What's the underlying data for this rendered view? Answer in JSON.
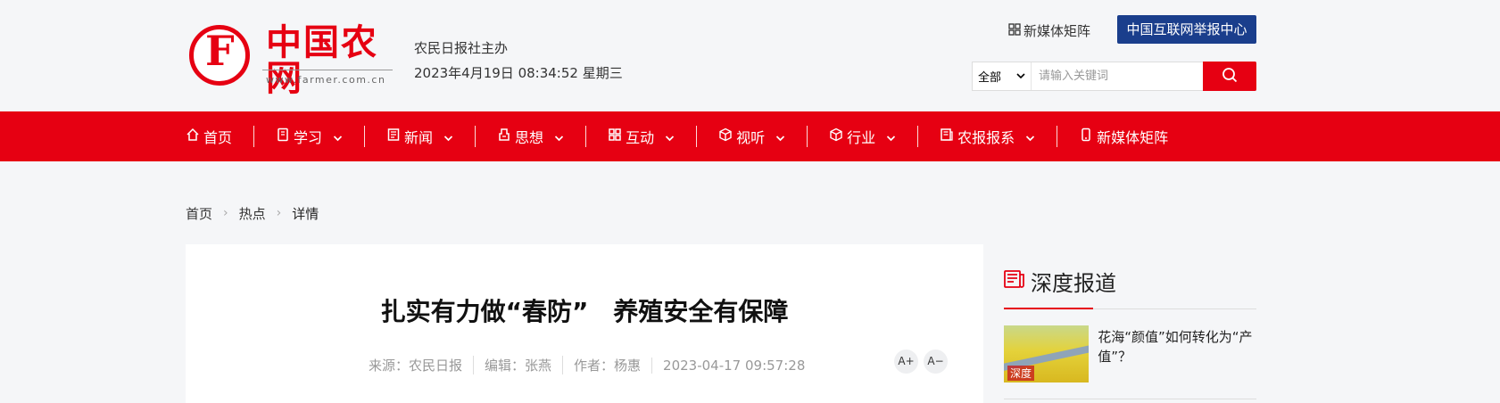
{
  "header": {
    "logo_title": "中国农网",
    "logo_url": "www.farmer.com.cn",
    "sponsor": "农民日报社主办",
    "datetime": "2023年4月19日 08:34:52 星期三",
    "media_link": "新媒体矩阵",
    "report_button": "中国互联网举报中心",
    "search_scope": "全部",
    "search_placeholder": "请输入关键词"
  },
  "nav": {
    "items": [
      {
        "label": "首页",
        "icon": "home-icon",
        "dropdown": false
      },
      {
        "label": "学习",
        "icon": "book-icon",
        "dropdown": true
      },
      {
        "label": "新闻",
        "icon": "news-icon",
        "dropdown": true
      },
      {
        "label": "思想",
        "icon": "lightbulb-icon",
        "dropdown": true
      },
      {
        "label": "互动",
        "icon": "grid-icon",
        "dropdown": true
      },
      {
        "label": "视听",
        "icon": "cube-icon",
        "dropdown": true
      },
      {
        "label": "行业",
        "icon": "box-icon",
        "dropdown": true
      },
      {
        "label": "农报报系",
        "icon": "newspaper-icon",
        "dropdown": true
      },
      {
        "label": "新媒体矩阵",
        "icon": "phone-icon",
        "dropdown": false
      }
    ]
  },
  "breadcrumb": {
    "home": "首页",
    "section": "热点",
    "current": "详情"
  },
  "article": {
    "title": "扎实有力做“春防”　养殖安全有保障",
    "source": "来源：农民日报",
    "editor": "编辑：张燕",
    "author": "作者：杨惠",
    "published": "2023-04-17 09:57:28",
    "font_increase": "A+",
    "font_decrease": "A−"
  },
  "sidebar": {
    "title": "深度报道",
    "items": [
      {
        "title": "花海“颜值”如何转化为“产值”？",
        "thumb_tag": "深度"
      }
    ]
  },
  "colors": {
    "brand_red": "#e60012",
    "report_blue": "#1a3e8c"
  }
}
